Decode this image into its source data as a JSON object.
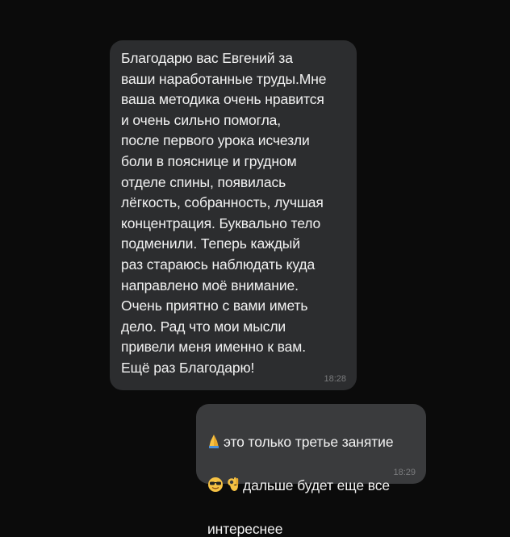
{
  "messages": [
    {
      "direction": "incoming",
      "text": "Благодарю вас Евгений за\nваши наработанные труды.Мне\nваша методика очень нравится\nи очень сильно помогла,\nпосле первого урока исчезли\nболи в пояснице и грудном\nотделе спины, появилась\nлёгкость, собранность, лучшая\nконцентрация. Буквально тело\nподменили. Теперь каждый\nраз стараюсь наблюдать куда\nнаправлено моё внимание.\nОчень приятно с вами иметь\nдело. Рад что мои мысли\nпривели меня именно к вам.\nЕщё раз Благодарю!",
      "time": "18:28"
    },
    {
      "direction": "outgoing",
      "line1": "это только третье занятие",
      "line2": "дальше будет еще все",
      "line3": "интереснее",
      "emojis": [
        "folded-hands-emoji",
        "sunglasses-emoji",
        "ok-hand-emoji"
      ],
      "time": "18:29"
    }
  ]
}
